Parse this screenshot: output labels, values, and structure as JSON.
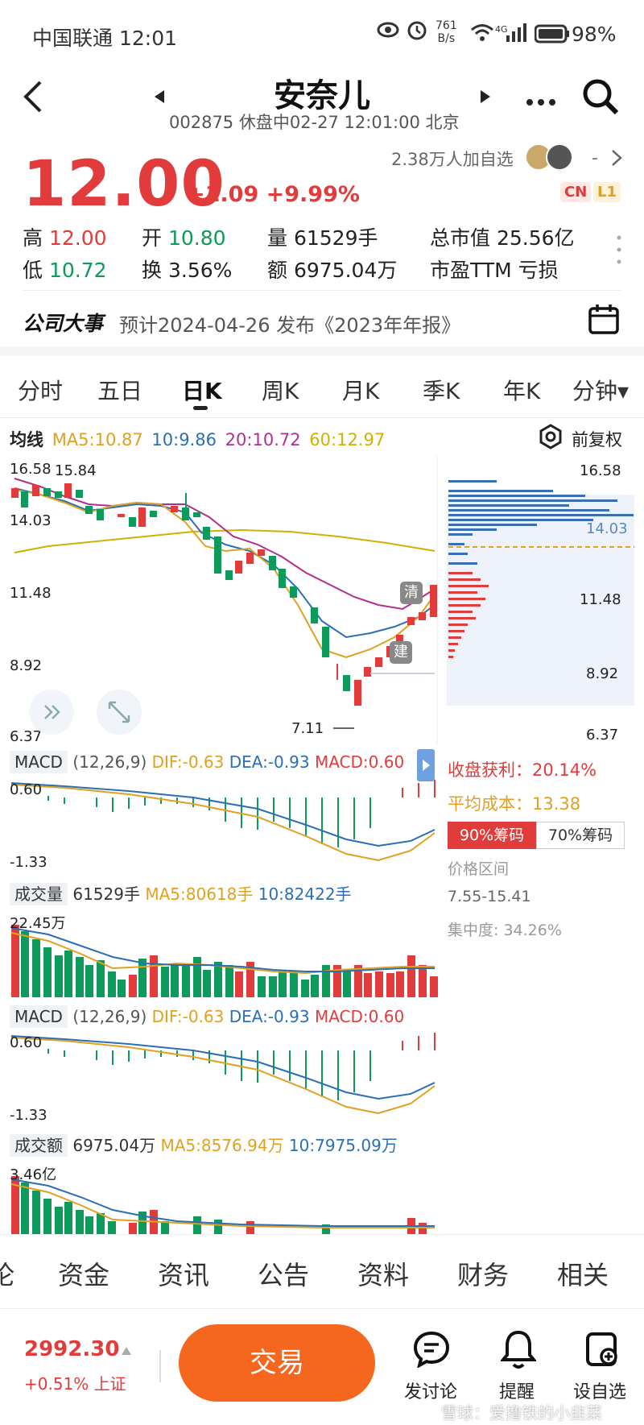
{
  "status": {
    "carrier": "中国联通",
    "time": "12:01",
    "speed": "761",
    "speed_unit": "B/s",
    "network": "4G",
    "battery": "98%"
  },
  "header": {
    "title": "安奈儿",
    "subtitle": "002875 休盘中02-27 12:01:00 北京"
  },
  "quote": {
    "price": "12.00",
    "change": "+1.09 +9.99%",
    "watchers": "2.38万人加自选",
    "chip_cn": "CN",
    "chip_l1": "L1",
    "price_color": "#e23b3b"
  },
  "stats": {
    "high_label": "高",
    "high": "12.00",
    "open_label": "开",
    "open": "10.80",
    "vol_label": "量",
    "vol": "61529手",
    "cap_label": "总市值",
    "cap": "25.56亿",
    "low_label": "低",
    "low": "10.72",
    "turn_label": "换",
    "turn": "3.56%",
    "amt_label": "额",
    "amt": "6975.04万",
    "pe_label": "市盈TTM",
    "pe": "亏损"
  },
  "event": {
    "label": "公司大事",
    "text": "预计2024-04-26 发布《2023年年报》"
  },
  "tabs": [
    "分时",
    "五日",
    "日K",
    "周K",
    "月K",
    "季K",
    "年K",
    "分钟▾"
  ],
  "ma": {
    "label": "均线",
    "ma5": "MA5:10.87",
    "ma10": "10:9.86",
    "ma20": "20:10.72",
    "ma60": "60:12.97",
    "adjust": "前复权"
  },
  "kline": {
    "ylabels": [
      "16.58",
      "14.03",
      "11.48",
      "8.92",
      "6.37"
    ],
    "high_mark": "15.84",
    "low_mark": "7.11",
    "tag_qing": "清",
    "tag_jian": "建",
    "rlabels": [
      "16.58",
      "14.03",
      "11.48",
      "8.92",
      "6.37"
    ]
  },
  "macd1": {
    "label": "MACD",
    "params": "(12,26,9)",
    "dif": "DIF:-0.63",
    "dea": "DEA:-0.93",
    "macd": "MACD:0.60",
    "top": "0.60",
    "bottom": "-1.33"
  },
  "chips": {
    "profit_label": "收盘获利：",
    "profit": "20.14%",
    "cost_label": "平均成本：",
    "cost": "13.38",
    "tab90": "90%筹码",
    "tab70": "70%筹码",
    "range_label": "价格区间",
    "range": "7.55-15.41",
    "conc": "集中度: 34.26%"
  },
  "vol": {
    "label": "成交量",
    "value": "61529手",
    "ma5": "MA5:80618手",
    "ma10": "10:82422手",
    "top": "22.45万"
  },
  "macd2": {
    "label": "MACD",
    "params": "(12,26,9)",
    "dif": "DIF:-0.63",
    "dea": "DEA:-0.93",
    "macd": "MACD:0.60",
    "top": "0.60",
    "bottom": "-1.33"
  },
  "amt": {
    "label": "成交额",
    "value": "6975.04万",
    "ma5": "MA5:8576.94万",
    "ma10": "10:7975.09万",
    "top": "3.46亿"
  },
  "bottom_tabs": [
    "论",
    "资金",
    "资讯",
    "公告",
    "资料",
    "财务",
    "相关"
  ],
  "footer": {
    "index_value": "2992.30",
    "index_change": "+0.51% 上证",
    "trade": "交易",
    "discuss": "发讨论",
    "remind": "提醒",
    "watch": "设自选",
    "watermark": "雪球：爱撸铁的小韭菜"
  }
}
